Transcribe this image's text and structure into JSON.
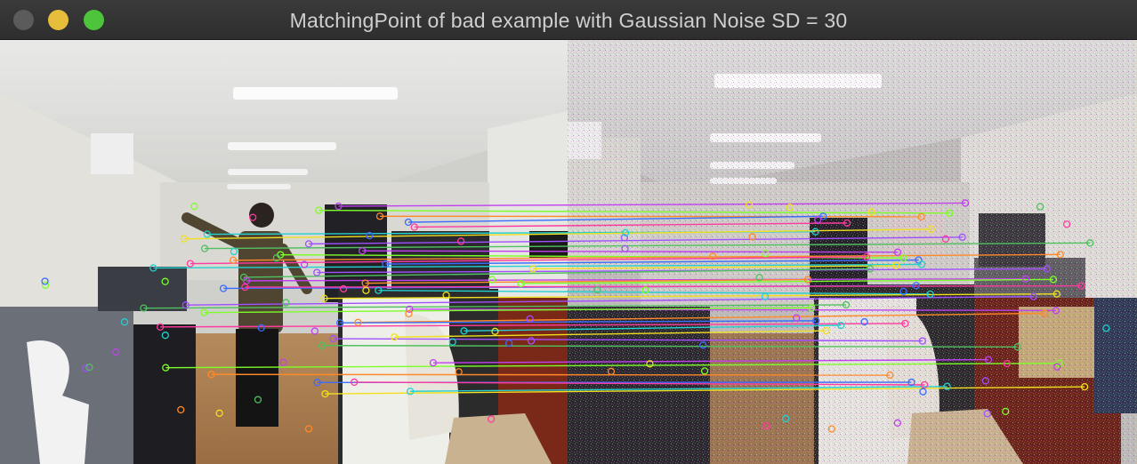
{
  "window": {
    "title": "MatchingPoint of bad example with Gaussian Noise SD = 30",
    "controls": [
      "close",
      "minimize",
      "maximize"
    ]
  },
  "colors": {
    "titlebar": "#2e2e2e",
    "close": "#5b5b5b",
    "minimize": "#e6bd3a",
    "maximize": "#4ec43c",
    "match_lines": [
      "#c040f0",
      "#7dff2a",
      "#ff8a2a",
      "#3a6cff",
      "#ff3aa0",
      "#24d0d0",
      "#f0e020",
      "#a050ff",
      "#50c060"
    ]
  },
  "panels": [
    "left-image-original",
    "right-image-noisy"
  ]
}
